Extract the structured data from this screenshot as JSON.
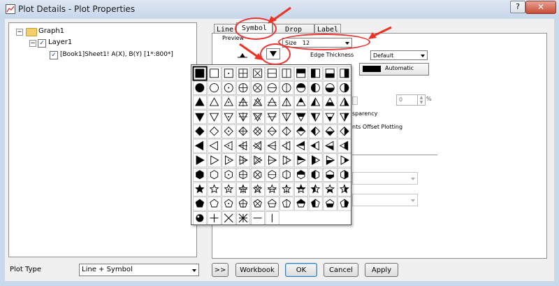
{
  "window": {
    "title": "Plot Details - Plot Properties",
    "help_label": "?",
    "close_label": "✕"
  },
  "tree": {
    "graph_label": "Graph1",
    "layer_label": "Layer1",
    "plot_label": "[Book1]Sheet1! A(X), B(Y) [1*:800*]",
    "expand_graph": "−",
    "expand_layer": "−"
  },
  "tabs": [
    {
      "label": "Line",
      "active": false
    },
    {
      "label": "Symbol",
      "active": true
    },
    {
      "label": "Drop Lines",
      "active": false
    },
    {
      "label": "Label",
      "active": false
    }
  ],
  "symbol": {
    "preview_label": "Preview",
    "size_label": "Size",
    "size_value": "12",
    "edge_thickness_label": "Edge Thickness",
    "edge_thickness_value": "Default",
    "color_value": "Automatic",
    "color_swatch": "#000000",
    "transparency_value": "0",
    "transparency_unit": "%",
    "transparency_label_partial": "sparency",
    "offset_label_partial": "nts Offset Plotting"
  },
  "bottom": {
    "plot_type_label": "Plot Type",
    "plot_type_value": "Line + Symbol",
    "expand_label": ">>",
    "workbook_label": "Workbook",
    "ok_label": "OK",
    "cancel_label": "Cancel",
    "apply_label": "Apply"
  },
  "colors": {
    "annotation_red": "#ee3322",
    "selection_blue": "#1d3f8a"
  }
}
